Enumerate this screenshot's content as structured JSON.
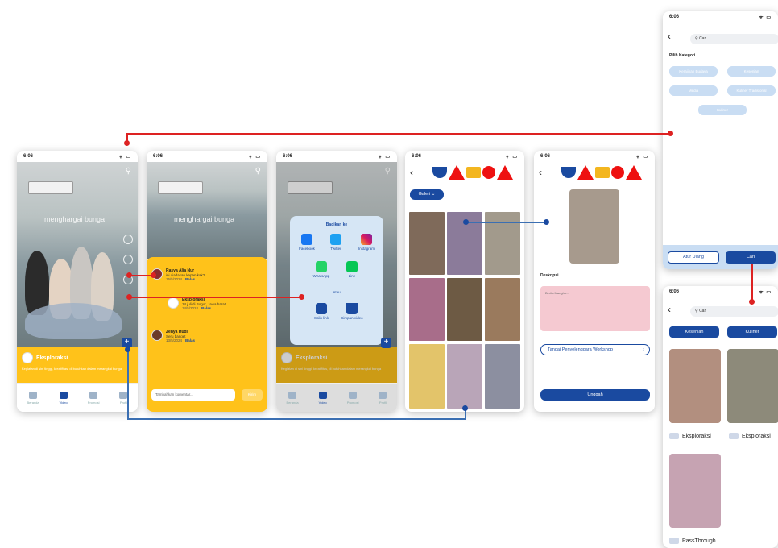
{
  "status_time": "6:06",
  "status_icons": "ᯤ ▭",
  "screen1": {
    "wall_text": "menghargai bunga",
    "channel": "Eksploraksi",
    "desc": "Kegiatan di sini tinggi, kreatifitas, di butuhkan dalam merangkai bunga",
    "nav": [
      "Beranda",
      "Video",
      "Promosi",
      "Profil"
    ]
  },
  "screen2": {
    "comments": [
      {
        "name": "Rasya Alia Nur",
        "text": "ini diadakan kapan kak?",
        "date": "15/5/2024",
        "reply": "Balas"
      },
      {
        "name": "Eksploraksi",
        "text": "14 juli di Bogor, Jawa barat",
        "date": "14/5/2024",
        "reply": "Balas"
      },
      {
        "name": "Zenya Hudi",
        "text": "Seru banget",
        "date": "13/5/2024",
        "reply": "Balas"
      }
    ],
    "input_placeholder": "Tambahkan komentar...",
    "send": "Kirim"
  },
  "screen3": {
    "share_title": "Bagikan ke",
    "share_items": [
      "Facebook",
      "Twitter",
      "Instagram",
      "WhatsApp",
      "Line"
    ],
    "or_label": "Atau",
    "actions": [
      "Salin link",
      "Simpan video"
    ],
    "channel": "Eksploraksi",
    "desc": "Kegiatan di sini tinggi, kreatifitas, di butuhkan dalam merangkai bunga",
    "nav": [
      "Beranda",
      "Video",
      "Promosi",
      "Profil"
    ]
  },
  "screen4": {
    "filter": "Galeri"
  },
  "screen5": {
    "desc_label": "Deskripsi",
    "desc_placeholder": "Berita Mangho...",
    "tag_btn": "Tandai Penyelenggara Workshop",
    "upload": "Unggah"
  },
  "screen6": {
    "search_value": "Cari",
    "section": "Pilih Kategori",
    "chips": [
      "Kerajinan Budaya",
      "Kesenian",
      "Media",
      "Kuliner Tradisional",
      "Kuliner"
    ],
    "reset": "Atur Ulang",
    "search_btn": "Cari"
  },
  "screen7": {
    "search_value": "Cari",
    "chips": [
      "Kesenian",
      "Kuliner"
    ],
    "cards": [
      "Eksploraksi",
      "Eksploraksi",
      "PassThrough"
    ]
  },
  "colors": {
    "accent": "#1a4aa0",
    "yellow": "#ffc21a",
    "link_red": "#d22",
    "link_blue": "#3b6fb2"
  }
}
